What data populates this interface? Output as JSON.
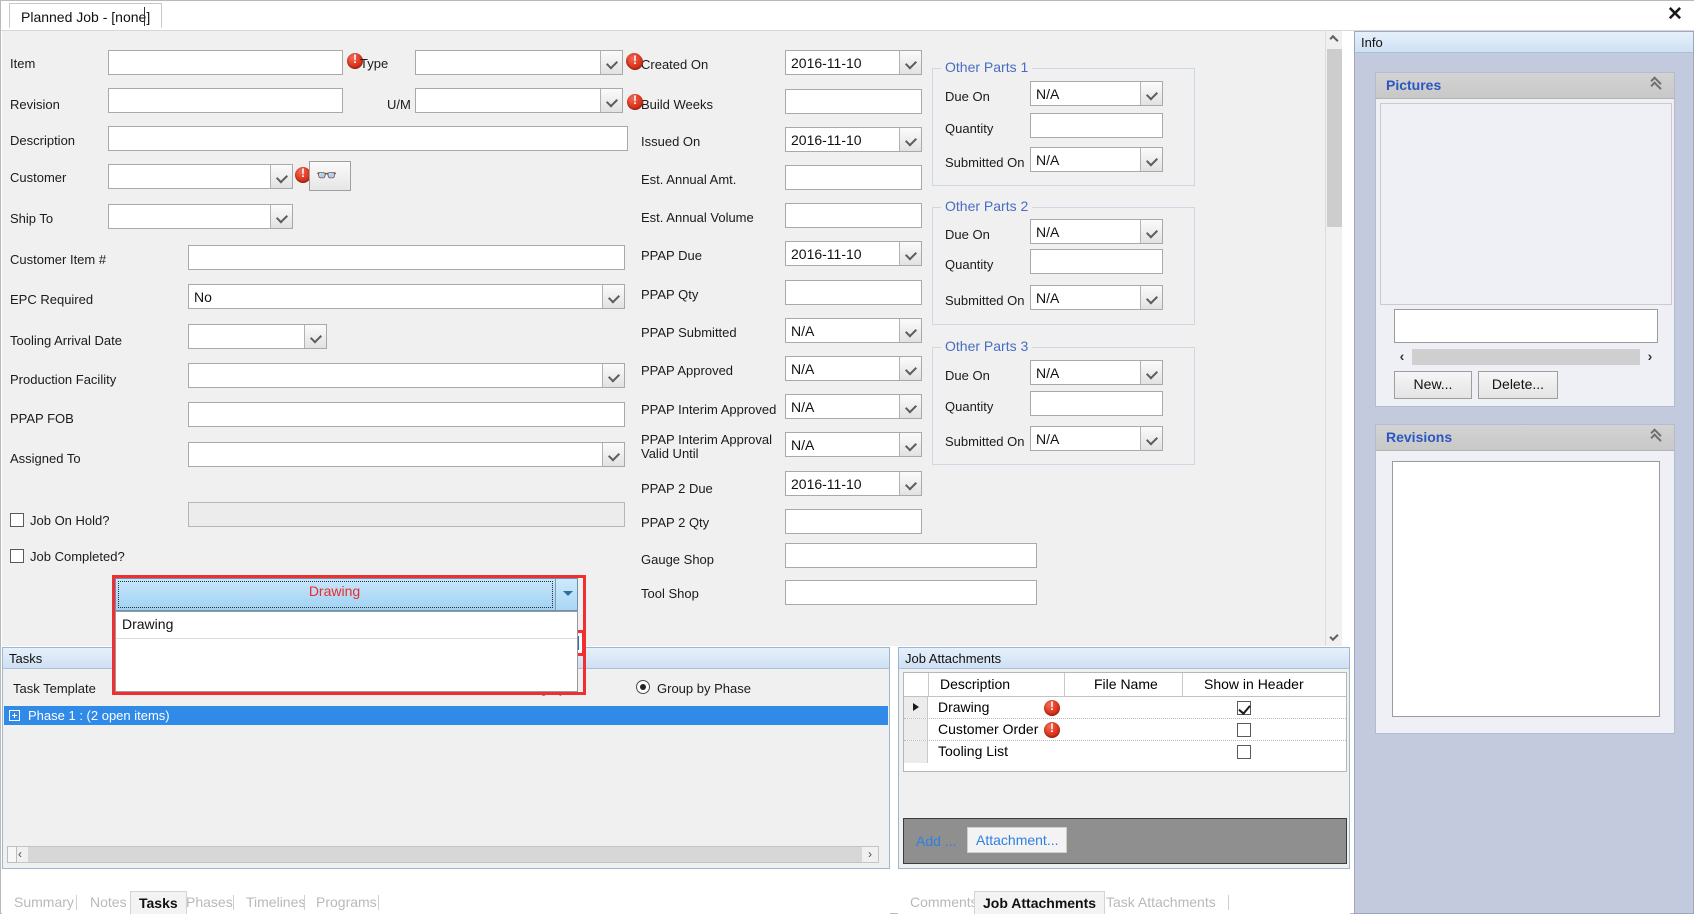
{
  "window": {
    "tab_title": "Planned Job - [none]",
    "close_label": "✕"
  },
  "form": {
    "left_fields": [
      {
        "label": "Item",
        "type": "textbox",
        "value": "",
        "required": true
      },
      {
        "label": "Revision",
        "type": "textbox",
        "value": ""
      },
      {
        "label": "Description",
        "type": "textbox",
        "value": ""
      },
      {
        "label": "Customer",
        "type": "combo",
        "value": "",
        "required": true
      },
      {
        "label": "Ship To",
        "type": "combo",
        "value": ""
      },
      {
        "label": "Customer Item #",
        "type": "textbox",
        "value": ""
      },
      {
        "label": "EPC Required",
        "type": "combo",
        "value": "No"
      },
      {
        "label": "Tooling Arrival Date",
        "type": "combo",
        "value": ""
      },
      {
        "label": "Production Facility",
        "type": "combo",
        "value": ""
      },
      {
        "label": "PPAP FOB",
        "type": "textbox",
        "value": ""
      },
      {
        "label": "Assigned To",
        "type": "combo",
        "value": ""
      }
    ],
    "second_col": [
      {
        "label": "Type",
        "type": "combo",
        "value": "",
        "required": true
      },
      {
        "label": "U/M",
        "type": "combo",
        "value": ""
      }
    ],
    "checkboxes": [
      {
        "label": "Job On Hold?",
        "checked": false
      },
      {
        "label": "Job Completed?",
        "checked": false
      }
    ],
    "middle_fields": [
      {
        "label": "Created On",
        "type": "combo",
        "value": "2016-11-10",
        "required": true
      },
      {
        "label": "Build Weeks",
        "type": "textbox",
        "value": "",
        "required": true
      },
      {
        "label": "Issued On",
        "type": "combo",
        "value": "2016-11-10"
      },
      {
        "label": "Est. Annual Amt.",
        "type": "textbox",
        "value": ""
      },
      {
        "label": "Est. Annual Volume",
        "type": "textbox",
        "value": ""
      },
      {
        "label": "PPAP Due",
        "type": "combo",
        "value": "2016-11-10"
      },
      {
        "label": "PPAP Qty",
        "type": "textbox",
        "value": ""
      },
      {
        "label": "PPAP Submitted",
        "type": "combo",
        "value": "N/A"
      },
      {
        "label": "PPAP Approved",
        "type": "combo",
        "value": "N/A"
      },
      {
        "label": "PPAP Interim Approved",
        "type": "combo",
        "value": "N/A"
      },
      {
        "label": "PPAP Interim Approval Valid Until",
        "type": "combo",
        "value": "N/A"
      },
      {
        "label": "PPAP 2 Due",
        "type": "combo",
        "value": "2016-11-10"
      },
      {
        "label": "PPAP 2 Qty",
        "type": "textbox",
        "value": ""
      },
      {
        "label": "Gauge Shop",
        "type": "textbox",
        "value": ""
      },
      {
        "label": "Tool Shop",
        "type": "textbox",
        "value": ""
      }
    ],
    "other_parts": [
      {
        "title": "Other Parts 1",
        "rows": [
          {
            "label": "Due On",
            "type": "combo",
            "value": "N/A"
          },
          {
            "label": "Quantity",
            "type": "textbox",
            "value": ""
          },
          {
            "label": "Submitted On",
            "type": "combo",
            "value": "N/A"
          }
        ]
      },
      {
        "title": "Other Parts 2",
        "rows": [
          {
            "label": "Due On",
            "type": "combo",
            "value": "N/A"
          },
          {
            "label": "Quantity",
            "type": "textbox",
            "value": ""
          },
          {
            "label": "Submitted On",
            "type": "combo",
            "value": "N/A"
          }
        ]
      },
      {
        "title": "Other Parts 3",
        "rows": [
          {
            "label": "Due On",
            "type": "combo",
            "value": "N/A"
          },
          {
            "label": "Quantity",
            "type": "textbox",
            "value": ""
          },
          {
            "label": "Submitted On",
            "type": "combo",
            "value": "N/A"
          }
        ]
      }
    ]
  },
  "dropdown": {
    "selected_value": "Drawing",
    "options": [
      "Drawing"
    ]
  },
  "tasks_panel": {
    "title": "Tasks",
    "task_template_label": "Task Template",
    "group_by_category_label": "egory",
    "group_by_phase_label": "Group by Phase",
    "group_by_phase_selected": true,
    "phase_row": "Phase 1 : (2 open items)",
    "scroll_left": "‹",
    "scroll_right": "›"
  },
  "bottom_tabs_left": {
    "items": [
      "Summary",
      "Notes",
      "Tasks",
      "Phases",
      "Timelines",
      "Programs"
    ],
    "active": "Tasks"
  },
  "attachments_panel": {
    "title": "Job Attachments",
    "columns": [
      "Description",
      "File Name",
      "Show in Header"
    ],
    "rows": [
      {
        "selected": true,
        "description": "Drawing",
        "has_error": true,
        "file_name": "",
        "show_in_header": true
      },
      {
        "selected": false,
        "description": "Customer Order",
        "has_error": true,
        "file_name": "",
        "show_in_header": false
      },
      {
        "selected": false,
        "description": "Tooling List",
        "has_error": false,
        "file_name": "",
        "show_in_header": false
      }
    ],
    "toolbar": {
      "add_label": "Add ...",
      "attachment_label": "Attachment..."
    }
  },
  "bottom_tabs_right": {
    "items": [
      "Comments",
      "Job Attachments",
      "Task Attachments"
    ],
    "active": "Job Attachments"
  },
  "info_pane": {
    "title": "Info",
    "pictures": {
      "title": "Pictures",
      "caption_value": "",
      "scroll_left": "‹",
      "scroll_right": "›",
      "new_label": "New...",
      "delete_label": "Delete..."
    },
    "revisions": {
      "title": "Revisions"
    }
  },
  "colors": {
    "accent_blue": "#2b58c0",
    "highlight_red": "#f03030",
    "selection_blue": "#2f8ae8",
    "link_blue": "#2f7fe0",
    "error_red": "#e23b22"
  }
}
